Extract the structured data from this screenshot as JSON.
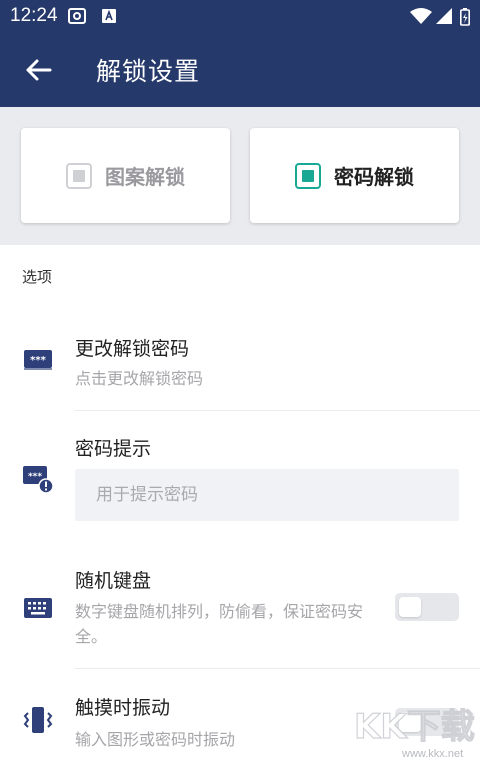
{
  "status_bar": {
    "time": "12:24",
    "icons": [
      "media-icon",
      "keyboard-a-icon",
      "wifi-icon",
      "signal-icon",
      "battery-icon"
    ]
  },
  "app_bar": {
    "title": "解锁设置",
    "back_icon": "arrow-left-icon"
  },
  "unlock_modes": [
    {
      "label": "图案解锁",
      "selected": false
    },
    {
      "label": "密码解锁",
      "selected": true
    }
  ],
  "options": {
    "section_title": "选项",
    "change_password": {
      "title": "更改解锁密码",
      "subtitle": "点击更改解锁密码",
      "icon": "password-card-icon"
    },
    "password_hint": {
      "title": "密码提示",
      "placeholder": "用于提示密码",
      "value": "",
      "icon": "password-alert-icon"
    },
    "random_keyboard": {
      "title": "随机键盘",
      "subtitle": "数字键盘随机排列，防偷看，保证密码安全。",
      "enabled": false,
      "icon": "keyboard-icon"
    },
    "haptic": {
      "title": "触摸时振动",
      "subtitle": "输入图形或密码时振动",
      "enabled": false,
      "icon": "vibrate-icon"
    }
  },
  "watermark": {
    "logo_text": "KK下载",
    "url": "www.kkx.net"
  },
  "colors": {
    "app_bar": "#26396b",
    "accent": "#18a893",
    "icon": "#2e3f7a",
    "panel_bg": "#eaebef"
  }
}
